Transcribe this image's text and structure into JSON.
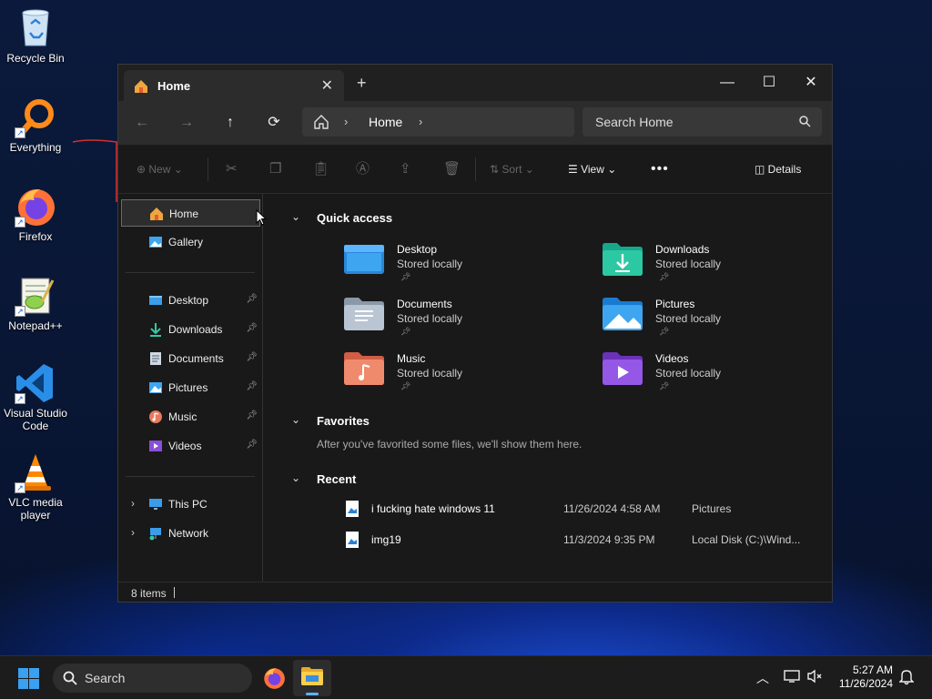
{
  "desktop": {
    "icons": [
      {
        "label": "Recycle Bin"
      },
      {
        "label": "Everything"
      },
      {
        "label": "Firefox"
      },
      {
        "label": "Notepad++"
      },
      {
        "label": "Visual Studio Code"
      },
      {
        "label": "VLC media player"
      }
    ]
  },
  "window": {
    "tab_title": "Home",
    "nav": {
      "breadcrumb": "Home",
      "search_placeholder": "Search Home"
    },
    "toolbar": {
      "new_label": "New",
      "sort_label": "Sort",
      "view_label": "View",
      "details_label": "Details"
    },
    "sidebar": {
      "home": "Home",
      "gallery": "Gallery",
      "pinned": [
        {
          "label": "Desktop"
        },
        {
          "label": "Downloads"
        },
        {
          "label": "Documents"
        },
        {
          "label": "Pictures"
        },
        {
          "label": "Music"
        },
        {
          "label": "Videos"
        }
      ],
      "this_pc": "This PC",
      "network": "Network"
    },
    "main": {
      "quick_access_title": "Quick access",
      "quick_access": [
        {
          "name": "Desktop",
          "status": "Stored locally"
        },
        {
          "name": "Downloads",
          "status": "Stored locally"
        },
        {
          "name": "Documents",
          "status": "Stored locally"
        },
        {
          "name": "Pictures",
          "status": "Stored locally"
        },
        {
          "name": "Music",
          "status": "Stored locally"
        },
        {
          "name": "Videos",
          "status": "Stored locally"
        }
      ],
      "favorites_title": "Favorites",
      "favorites_empty": "After you've favorited some files, we'll show them here.",
      "recent_title": "Recent",
      "recent": [
        {
          "name": "i fucking hate windows 11",
          "date": "11/26/2024 4:58 AM",
          "location": "Pictures"
        },
        {
          "name": "img19",
          "date": "11/3/2024 9:35 PM",
          "location": "Local Disk (C:)\\Wind..."
        }
      ]
    },
    "status": {
      "items": "8 items"
    }
  },
  "taskbar": {
    "search_label": "Search",
    "time": "5:27 AM",
    "date": "11/26/2024"
  }
}
